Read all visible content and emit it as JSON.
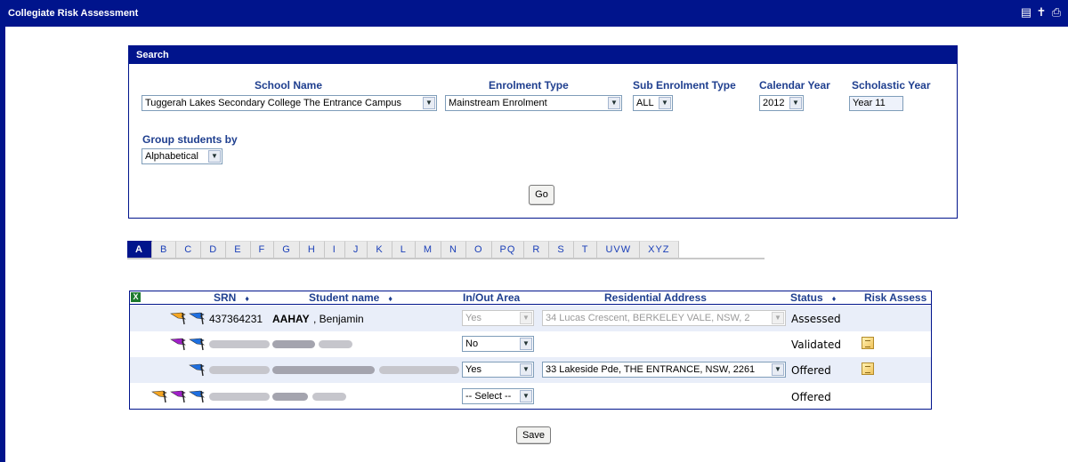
{
  "app": {
    "title": "Collegiate Risk Assessment",
    "icons": [
      "document-icon",
      "help-person-icon",
      "print-icon"
    ]
  },
  "search": {
    "heading": "Search",
    "school_label": "School Name",
    "school_value": "Tuggerah Lakes Secondary College The Entrance Campus",
    "enrolment_label": "Enrolment Type",
    "enrolment_value": "Mainstream Enrolment",
    "sub_enrolment_label": "Sub Enrolment Type",
    "sub_enrolment_value": "ALL",
    "calendar_label": "Calendar Year",
    "calendar_value": "2012",
    "scholastic_label": "Scholastic Year",
    "scholastic_value": "Year 11",
    "group_label": "Group students by",
    "group_value": "Alphabetical",
    "go_label": "Go"
  },
  "alphabet_tabs": [
    "A",
    "B",
    "C",
    "D",
    "E",
    "F",
    "G",
    "H",
    "I",
    "J",
    "K",
    "L",
    "M",
    "N",
    "O",
    "PQ",
    "R",
    "S",
    "T",
    "UVW",
    "XYZ"
  ],
  "active_tab": "A",
  "table": {
    "excel_icon": "excel-export-icon",
    "headers": {
      "srn": "SRN",
      "name": "Student name",
      "inout": "In/Out Area",
      "address": "Residential Address",
      "status": "Status",
      "risk": "Risk Assess"
    },
    "sort_glyph": "♦",
    "rows": [
      {
        "srn": "437364231",
        "surname": "AAHAY",
        "given": ", Benjamin",
        "inout": "Yes",
        "inout_disabled": true,
        "address": "34 Lucas Crescent, BERKELEY VALE, NSW, 2",
        "address_disabled": true,
        "status": "Assessed",
        "flags": [
          "orange",
          "blue"
        ],
        "risk_icon": false
      },
      {
        "srn": "",
        "surname": "",
        "given": "",
        "inout": "No",
        "inout_disabled": false,
        "address": "",
        "address_disabled": false,
        "status": "Validated",
        "flags": [
          "purple",
          "blue"
        ],
        "risk_icon": true
      },
      {
        "srn": "",
        "surname": "",
        "given": "",
        "inout": "Yes",
        "inout_disabled": false,
        "address": "33 Lakeside Pde, THE ENTRANCE, NSW, 2261",
        "address_disabled": false,
        "status": "Offered",
        "flags": [
          "blue"
        ],
        "risk_icon": true
      },
      {
        "srn": "",
        "surname": "",
        "given": "",
        "inout": "-- Select --",
        "inout_disabled": false,
        "address": "",
        "address_disabled": false,
        "status": "Offered",
        "flags": [
          "orange",
          "purple",
          "blue"
        ],
        "risk_icon": false
      }
    ]
  },
  "save_label": "Save",
  "colors": {
    "brand": "#00148c",
    "flag_orange": "#f5a623",
    "flag_purple": "#a020c8",
    "flag_blue": "#1e6fe0"
  }
}
